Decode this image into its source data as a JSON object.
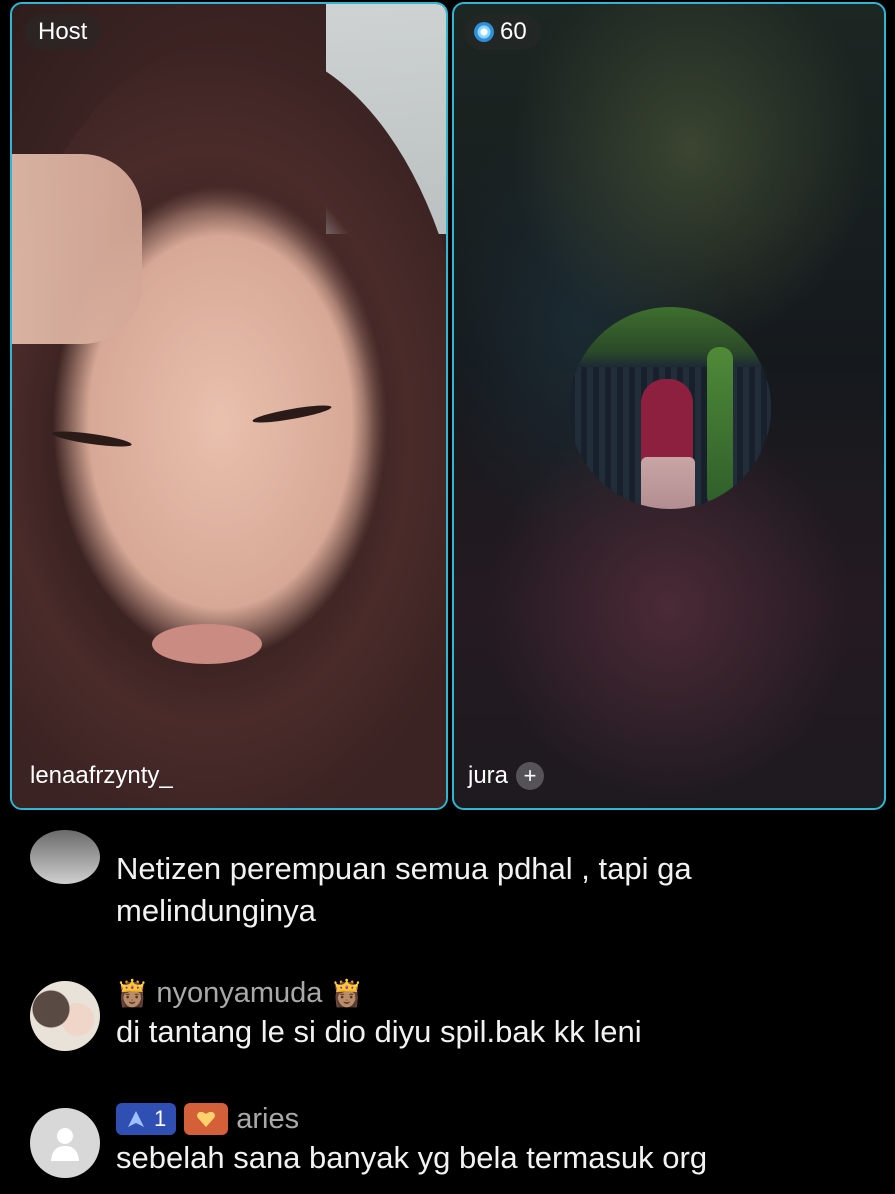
{
  "live": {
    "host_badge": "Host",
    "viewer_count": "60",
    "host_name": "lenaafrzynty_",
    "guest_name": "jura",
    "follow_symbol": "+",
    "border_color": "#2fb6d3"
  },
  "comments": [
    {
      "username": "",
      "text": "Netizen perempuan semua pdhal , tapi ga melindunginya",
      "avatar_icon": "default-avatar"
    },
    {
      "username": "nyonyamuda",
      "prefix_emoji": "👸🏽",
      "suffix_emoji": "👸🏽",
      "text": "di tantang le si dio diyu spil.bak kk leni",
      "avatar_icon": "couple-photo-avatar"
    },
    {
      "username": "aries",
      "level_badge": "1",
      "text": "sebelah sana banyak yg bela termasuk org",
      "avatar_icon": "default-avatar"
    }
  ]
}
